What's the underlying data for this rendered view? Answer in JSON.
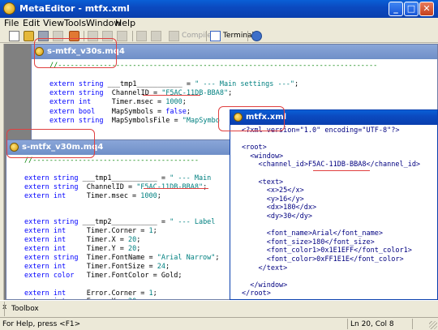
{
  "window": {
    "title": "MetaEditor - mtfx.xml",
    "minimize": "_",
    "maximize": "□",
    "close": "✕"
  },
  "menu": [
    "File",
    "Edit",
    "View",
    "Tools",
    "Window",
    "Help"
  ],
  "toolbar": {
    "compile_label": "Compile",
    "terminal_label": "Terminal"
  },
  "windows": {
    "v30s": {
      "title": "s-mtfx_v30s.mq4",
      "lines": [
        [
          [
            "cm",
            "//-----------------------------------------------------------------------------"
          ]
        ],
        [],
        [
          [
            "kw",
            "extern string "
          ],
          [
            "id",
            "___tmp1___________ = "
          ],
          [
            "str",
            "\" --- Main settings ---\""
          ],
          [
            "id",
            ";"
          ]
        ],
        [
          [
            "kw",
            "extern string  "
          ],
          [
            "id",
            "ChannelID = "
          ],
          [
            "str",
            "\"F5AC-11DB-BBA8\""
          ],
          [
            "id",
            ";"
          ]
        ],
        [
          [
            "kw",
            "extern int     "
          ],
          [
            "id",
            "Timer.msec = "
          ],
          [
            "num",
            "1000"
          ],
          [
            "id",
            ";"
          ]
        ],
        [
          [
            "kw",
            "extern bool    "
          ],
          [
            "id",
            "MapSymbols = "
          ],
          [
            "kw",
            "false"
          ],
          [
            "id",
            ";"
          ]
        ],
        [
          [
            "kw",
            "extern string  "
          ],
          [
            "id",
            "MapSymbolsFile = "
          ],
          [
            "str",
            "\"MapSymbo"
          ]
        ]
      ]
    },
    "v30m": {
      "title": "s-mtfx_v30m.mq4",
      "lines": [
        [
          [
            "cm",
            "//----------------------------------------"
          ]
        ],
        [],
        [
          [
            "kw",
            "extern string "
          ],
          [
            "id",
            "___tmp1___________ = "
          ],
          [
            "str",
            "\" --- Main"
          ]
        ],
        [
          [
            "kw",
            "extern string  "
          ],
          [
            "id",
            "ChannelID = "
          ],
          [
            "str",
            "\"F5AC-11DB-BBA8\""
          ],
          [
            "id",
            ";"
          ]
        ],
        [
          [
            "kw",
            "extern int     "
          ],
          [
            "id",
            "Timer.msec = "
          ],
          [
            "num",
            "1000"
          ],
          [
            "id",
            ";"
          ]
        ],
        [],
        [],
        [
          [
            "kw",
            "extern string "
          ],
          [
            "id",
            "___tmp2___________ = "
          ],
          [
            "str",
            "\" --- Label"
          ]
        ],
        [
          [
            "kw",
            "extern int     "
          ],
          [
            "id",
            "Timer.Corner = "
          ],
          [
            "num",
            "1"
          ],
          [
            "id",
            ";"
          ]
        ],
        [
          [
            "kw",
            "extern int     "
          ],
          [
            "id",
            "Timer.X = "
          ],
          [
            "num",
            "20"
          ],
          [
            "id",
            ";"
          ]
        ],
        [
          [
            "kw",
            "extern int     "
          ],
          [
            "id",
            "Timer.Y = "
          ],
          [
            "num",
            "20"
          ],
          [
            "id",
            ";"
          ]
        ],
        [
          [
            "kw",
            "extern string  "
          ],
          [
            "id",
            "Timer.FontName = "
          ],
          [
            "str",
            "\"Arial Narrow\""
          ],
          [
            "id",
            ";"
          ]
        ],
        [
          [
            "kw",
            "extern int     "
          ],
          [
            "id",
            "Timer.FontSize = "
          ],
          [
            "num",
            "24"
          ],
          [
            "id",
            ";"
          ]
        ],
        [
          [
            "kw",
            "extern color   "
          ],
          [
            "id",
            "Timer.FontColor = Gold;"
          ]
        ],
        [],
        [
          [
            "kw",
            "extern int     "
          ],
          [
            "id",
            "Error.Corner = "
          ],
          [
            "num",
            "1"
          ],
          [
            "id",
            ";"
          ]
        ],
        [
          [
            "kw",
            "extern int     "
          ],
          [
            "id",
            "Error.X = "
          ],
          [
            "num",
            "20"
          ],
          [
            "id",
            ";"
          ]
        ]
      ]
    },
    "xml": {
      "title": "mtfx.xml",
      "lines": [
        [
          [
            "xml",
            "<?xml version=\"1.0\" encoding=\"UTF-8\"?>"
          ]
        ],
        [],
        [
          [
            "xml",
            "<root>"
          ]
        ],
        [
          [
            "xml",
            "  <window>"
          ]
        ],
        [
          [
            "xml",
            "    <channel_id>F5AC-11DB-BBA8</channel_id>"
          ]
        ],
        [],
        [
          [
            "xml",
            "    <text>"
          ]
        ],
        [
          [
            "xml",
            "      <x>25</x>"
          ]
        ],
        [
          [
            "xml",
            "      <y>16</y>"
          ]
        ],
        [
          [
            "xml",
            "      <dx>180</dx>"
          ]
        ],
        [
          [
            "xml",
            "      <dy>30</dy>"
          ]
        ],
        [],
        [
          [
            "xml",
            "      <font_name>Arial</font_name>"
          ]
        ],
        [
          [
            "xml",
            "      <font_size>180</font_size>"
          ]
        ],
        [
          [
            "xml",
            "      <font_color1>0x1E1EFF</font_color1>"
          ]
        ],
        [
          [
            "xml",
            "      <font_color>0xFF1E1E</font_color>"
          ]
        ],
        [
          [
            "xml",
            "    </text>"
          ]
        ],
        [],
        [
          [
            "xml",
            "  </window>"
          ]
        ],
        [
          [
            "xml",
            "</root>"
          ]
        ]
      ]
    }
  },
  "toolbox": {
    "close": "x",
    "label": "Toolbox"
  },
  "status": {
    "help_text": "For Help, press <F1>",
    "position": "Ln 20, Col 8"
  },
  "colors": {
    "keyword": "#0000ff",
    "comment": "#008000",
    "string": "#008080",
    "annotation": "#e04040",
    "titlebar_active": "#0b4ac0"
  }
}
